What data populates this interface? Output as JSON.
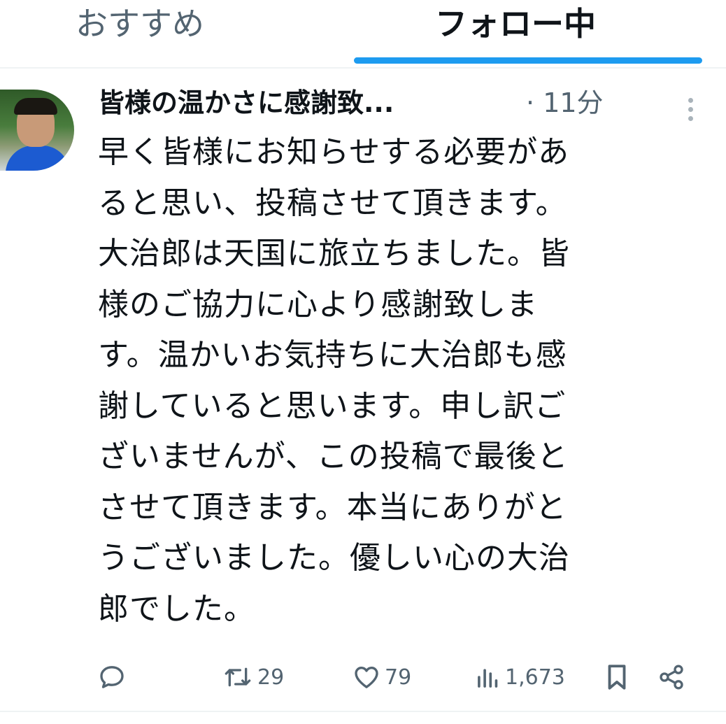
{
  "tabs": [
    {
      "label": "おすすめ",
      "active": false
    },
    {
      "label": "フォロー中",
      "active": true
    }
  ],
  "colors": {
    "accent": "#1d9bf0",
    "text": "#0f1419",
    "secondary": "#536471"
  },
  "post": {
    "author_name": "皆様の温かさに感謝致...",
    "separator": "·",
    "time": "11分",
    "text_lines": [
      "早く皆様にお知らせする必要があ",
      "ると思い、投稿させて頂きます。",
      "大治郎は天国に旅立ちました。皆",
      "様のご協力に心より感謝致しま",
      "す。温かいお気持ちに大治郎も感",
      "謝していると思います。申し訳ご",
      "ざいませんが、この投稿で最後と",
      "させて頂きます。本当にありがと",
      "うございました。優しい心の大治",
      "郎でした。"
    ],
    "actions": {
      "reply": {
        "icon": "reply-icon",
        "count": ""
      },
      "repost": {
        "icon": "repost-icon",
        "count": "29"
      },
      "like": {
        "icon": "heart-icon",
        "count": "79"
      },
      "views": {
        "icon": "views-icon",
        "count": "1,673"
      },
      "bookmark": {
        "icon": "bookmark-icon"
      },
      "share": {
        "icon": "share-icon"
      }
    }
  }
}
